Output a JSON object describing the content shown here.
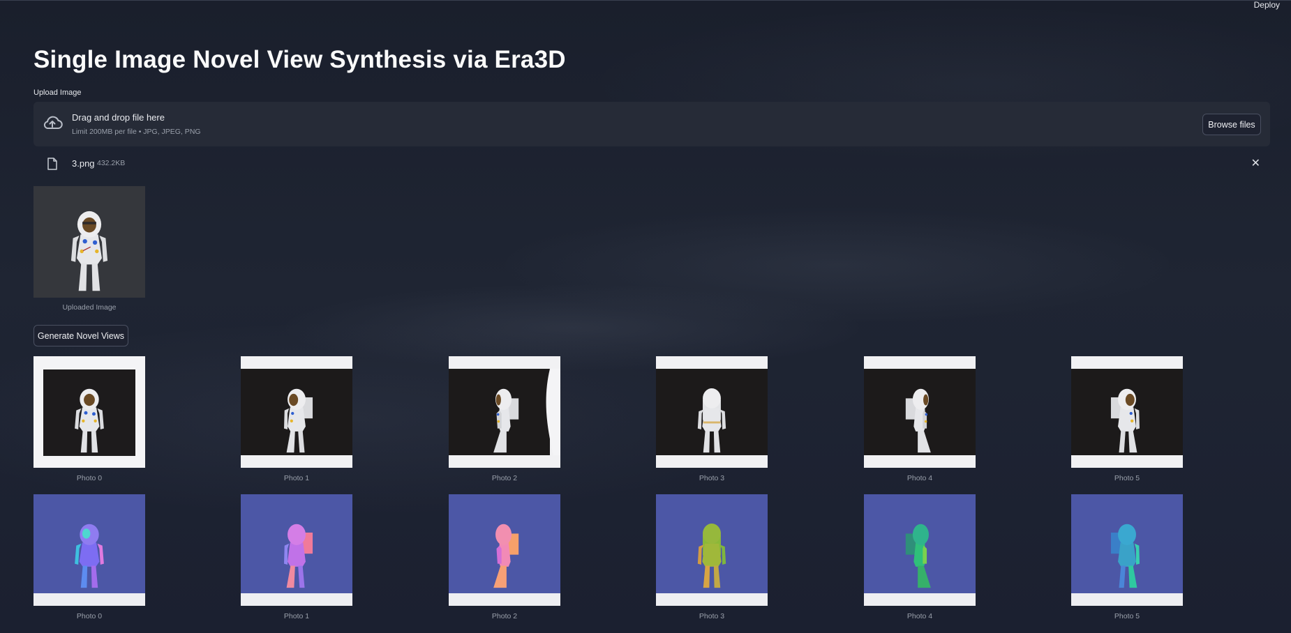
{
  "header": {
    "deploy_label": "Deploy"
  },
  "page_title": "Single Image Novel View Synthesis via Era3D",
  "uploader": {
    "label": "Upload Image",
    "dropzone_text": "Drag and drop file here",
    "limit_text": "Limit 200MB per file • JPG, JPEG, PNG",
    "browse_label": "Browse files",
    "upload_icon": "cloud-upload-icon"
  },
  "uploaded_file": {
    "name": "3.png",
    "size": "432.2KB",
    "file_icon": "file-icon",
    "remove_icon": "close-icon"
  },
  "uploaded_image": {
    "caption": "Uploaded Image"
  },
  "generate_button": "Generate Novel Views",
  "color_views": [
    {
      "caption": "Photo 0"
    },
    {
      "caption": "Photo 1"
    },
    {
      "caption": "Photo 2"
    },
    {
      "caption": "Photo 3"
    },
    {
      "caption": "Photo 4"
    },
    {
      "caption": "Photo 5"
    }
  ],
  "normal_views": [
    {
      "caption": "Photo 0"
    },
    {
      "caption": "Photo 1"
    },
    {
      "caption": "Photo 2"
    },
    {
      "caption": "Photo 3"
    },
    {
      "caption": "Photo 4"
    },
    {
      "caption": "Photo 5"
    }
  ]
}
